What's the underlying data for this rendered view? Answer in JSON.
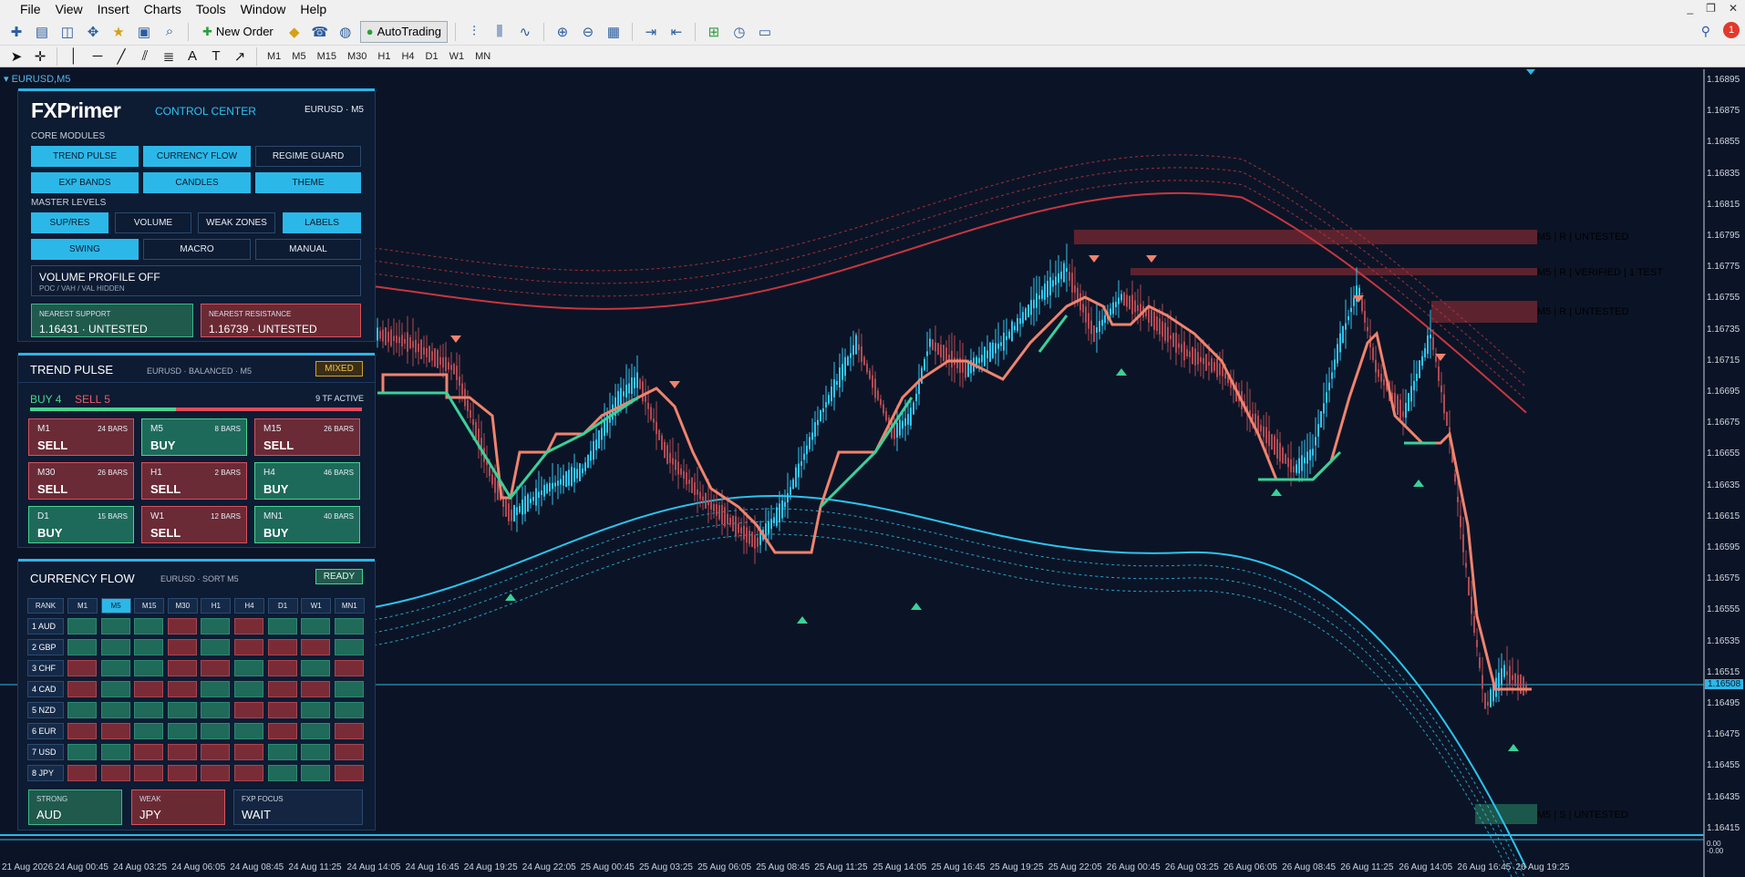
{
  "menu": [
    "File",
    "View",
    "Insert",
    "Charts",
    "Tools",
    "Window",
    "Help"
  ],
  "toolbar": {
    "new_order": "New Order",
    "autotrading": "AutoTrading"
  },
  "timeframes": [
    "M1",
    "M5",
    "M15",
    "M30",
    "H1",
    "H4",
    "D1",
    "W1",
    "MN"
  ],
  "chart": {
    "symbol_label": "EURUSD,M5",
    "current_price": "1.16508",
    "price_axis": [
      "1.16895",
      "1.16875",
      "1.16855",
      "1.16835",
      "1.16815",
      "1.16795",
      "1.16775",
      "1.16755",
      "1.16735",
      "1.16715",
      "1.16695",
      "1.16675",
      "1.16655",
      "1.16635",
      "1.16615",
      "1.16595",
      "1.16575",
      "1.16555",
      "1.16535",
      "1.16515",
      "1.16495",
      "1.16475",
      "1.16455",
      "1.16435",
      "1.16415"
    ],
    "time_axis": [
      "21 Aug 2026",
      "24 Aug 00:45",
      "24 Aug 03:25",
      "24 Aug 06:05",
      "24 Aug 08:45",
      "24 Aug 11:25",
      "24 Aug 14:05",
      "24 Aug 16:45",
      "24 Aug 19:25",
      "24 Aug 22:05",
      "25 Aug 00:45",
      "25 Aug 03:25",
      "25 Aug 06:05",
      "25 Aug 08:45",
      "25 Aug 11:25",
      "25 Aug 14:05",
      "25 Aug 16:45",
      "25 Aug 19:25",
      "25 Aug 22:05",
      "26 Aug 00:45",
      "26 Aug 03:25",
      "26 Aug 06:05",
      "26 Aug 08:45",
      "26 Aug 11:25",
      "26 Aug 14:05",
      "26 Aug 16:45",
      "26 Aug 19:25"
    ],
    "zones": [
      {
        "label": "M5 | R | UNTESTED",
        "color": "#f08080"
      },
      {
        "label": "M5 | R | VERIFIED | 1 TEST",
        "color": "#f08080"
      },
      {
        "label": "M5 | R | UNTESTED",
        "color": "#f08080"
      },
      {
        "label": "M5 | S | UNTESTED",
        "color": "#4fd6b0"
      }
    ],
    "sub_axis": [
      "0.00",
      "-0.00"
    ]
  },
  "control_center": {
    "logo": "FXPrimer",
    "title": "CONTROL CENTER",
    "symbol": "EURUSD · M5",
    "core_label": "CORE MODULES",
    "core": [
      {
        "label": "TREND PULSE",
        "on": true
      },
      {
        "label": "CURRENCY FLOW",
        "on": true
      },
      {
        "label": "REGIME GUARD",
        "on": false
      },
      {
        "label": "EXP BANDS",
        "on": true
      },
      {
        "label": "CANDLES",
        "on": true
      },
      {
        "label": "THEME",
        "on": true
      }
    ],
    "master_label": "MASTER LEVELS",
    "master": [
      {
        "label": "SUP/RES",
        "on": true
      },
      {
        "label": "VOLUME",
        "on": false
      },
      {
        "label": "WEAK ZONES",
        "on": false
      },
      {
        "label": "LABELS",
        "on": true
      },
      {
        "label": "SWING",
        "on": true
      },
      {
        "label": "MACRO",
        "on": false
      },
      {
        "label": "MANUAL",
        "on": false
      }
    ],
    "volume_title": "VOLUME PROFILE OFF",
    "volume_sub": "POC / VAH / VAL HIDDEN",
    "support_label": "NEAREST SUPPORT",
    "support_value": "1.16431  ·  UNTESTED",
    "resistance_label": "NEAREST RESISTANCE",
    "resistance_value": "1.16739  ·  UNTESTED"
  },
  "trend_pulse": {
    "title": "TREND PULSE",
    "sub": "EURUSD · BALANCED · M5",
    "tag": "MIXED",
    "buy": "BUY 4",
    "sell": "SELL 5",
    "active": "9 TF ACTIVE",
    "buy_fraction": 0.44,
    "cards": [
      {
        "tf": "M1",
        "bars": "24 BARS",
        "signal": "SELL"
      },
      {
        "tf": "M5",
        "bars": "8 BARS",
        "signal": "BUY"
      },
      {
        "tf": "M15",
        "bars": "26 BARS",
        "signal": "SELL"
      },
      {
        "tf": "M30",
        "bars": "26 BARS",
        "signal": "SELL"
      },
      {
        "tf": "H1",
        "bars": "2 BARS",
        "signal": "SELL"
      },
      {
        "tf": "H4",
        "bars": "46 BARS",
        "signal": "BUY"
      },
      {
        "tf": "D1",
        "bars": "15 BARS",
        "signal": "BUY"
      },
      {
        "tf": "W1",
        "bars": "12 BARS",
        "signal": "SELL"
      },
      {
        "tf": "MN1",
        "bars": "40 BARS",
        "signal": "BUY"
      }
    ]
  },
  "currency_flow": {
    "title": "CURRENCY FLOW",
    "sub": "EURUSD · SORT M5",
    "tag": "READY",
    "headers": [
      "RANK",
      "M1",
      "M5",
      "M15",
      "M30",
      "H1",
      "H4",
      "D1",
      "W1",
      "MN1"
    ],
    "rows": [
      {
        "label": "1 AUD",
        "cells": "gggrgrggg"
      },
      {
        "label": "2 GBP",
        "cells": "gggrgrrrg"
      },
      {
        "label": "3 CHF",
        "cells": "rggrrgrgr"
      },
      {
        "label": "4 CAD",
        "cells": "rgrrggrrg"
      },
      {
        "label": "5 NZD",
        "cells": "gggggrrgg"
      },
      {
        "label": "6 EUR",
        "cells": "rrggggrgr"
      },
      {
        "label": "7 USD",
        "cells": "ggrrrrggr"
      },
      {
        "label": "8 JPY",
        "cells": "rrrrrrggr"
      }
    ],
    "strong_label": "STRONG",
    "strong": "AUD",
    "weak_label": "WEAK",
    "weak": "JPY",
    "focus_label": "FXP FOCUS",
    "focus": "WAIT"
  }
}
